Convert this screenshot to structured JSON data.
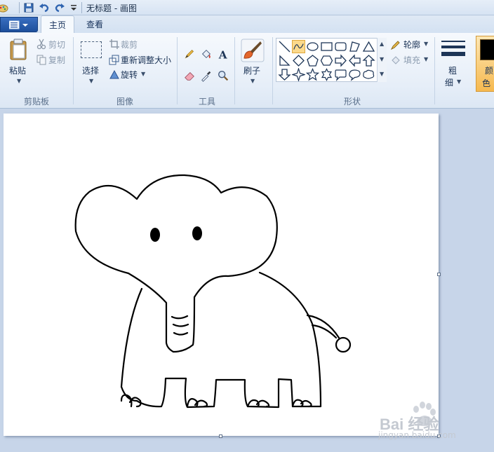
{
  "title": "无标题 - 画图",
  "tabs": [
    {
      "label": "主页",
      "active": true
    },
    {
      "label": "查看",
      "active": false
    }
  ],
  "clipboard": {
    "paste_label": "粘贴",
    "cut_label": "剪切",
    "copy_label": "复制",
    "group_label": "剪贴板"
  },
  "image": {
    "select_label": "选择",
    "crop_label": "裁剪",
    "resize_label": "重新调整大小",
    "rotate_label": "旋转",
    "group_label": "图像"
  },
  "tools": {
    "group_label": "工具"
  },
  "brushes": {
    "label": "刷子"
  },
  "shapes": {
    "outline_label": "轮廓",
    "fill_label": "填充",
    "group_label": "形状"
  },
  "size": {
    "label_line1": "粗",
    "label_line2": "细"
  },
  "colors": {
    "label_line1": "颜",
    "label_line2": "色",
    "color1": "#000000",
    "accent": "#f6b94f"
  },
  "watermark": {
    "brand": "Bai 经验",
    "url": "jingyan.baidu.com"
  }
}
